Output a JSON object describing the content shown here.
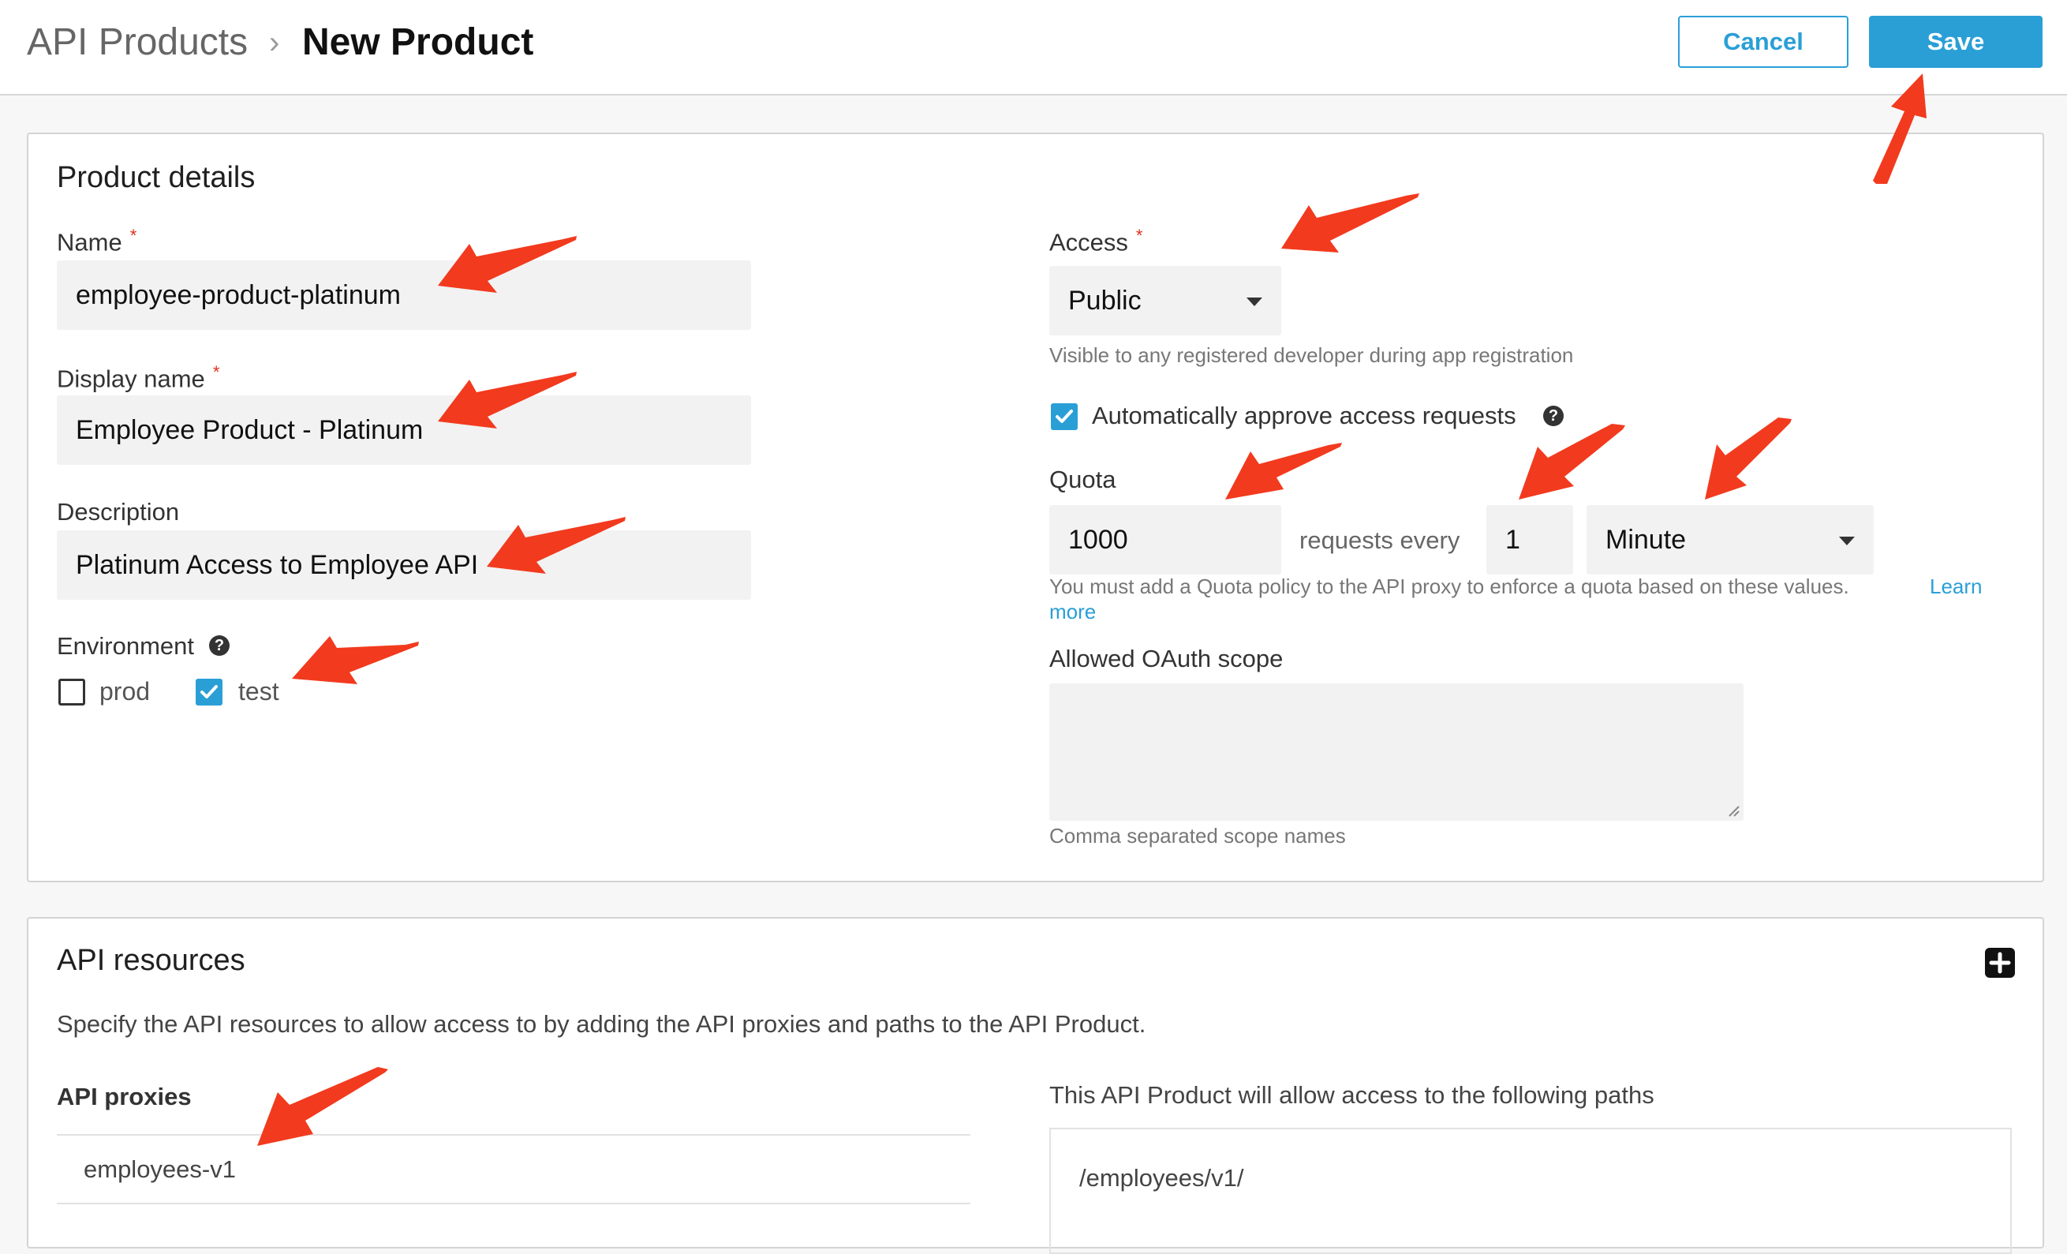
{
  "header": {
    "breadcrumb_parent": "API Products",
    "breadcrumb_sep": "›",
    "breadcrumb_current": "New Product",
    "cancel_label": "Cancel",
    "save_label": "Save"
  },
  "product_details": {
    "title": "Product details",
    "name": {
      "label": "Name",
      "required": "*",
      "value": "employee-product-platinum"
    },
    "display_name": {
      "label": "Display name",
      "required": "*",
      "value": "Employee Product - Platinum"
    },
    "description": {
      "label": "Description",
      "value": "Platinum Access to Employee API"
    },
    "environment": {
      "label": "Environment",
      "help_icon": "?",
      "options": [
        {
          "label": "prod",
          "checked": false
        },
        {
          "label": "test",
          "checked": true
        }
      ]
    },
    "access": {
      "label": "Access",
      "required": "*",
      "value": "Public",
      "hint": "Visible to any registered developer during app registration"
    },
    "auto_approve": {
      "label": "Automatically approve access requests",
      "checked": true,
      "help_icon": "?"
    },
    "quota": {
      "label": "Quota",
      "amount": "1000",
      "requests_every": "requests every",
      "interval": "1",
      "unit": "Minute",
      "hint": "You must add a Quota policy to the API proxy to enforce a quota based on these values.",
      "learn_more": "Learn more",
      "learn_more_line1": "Learn",
      "learn_more_line2": "more"
    },
    "oauth_scope": {
      "label": "Allowed OAuth scope",
      "value": "",
      "hint": "Comma separated scope names"
    }
  },
  "api_resources": {
    "title": "API resources",
    "description": "Specify the API resources to allow access to by adding the API proxies and paths to the API Product.",
    "add_icon": "plus-square-icon",
    "proxies_label": "API proxies",
    "proxies": [
      "employees-v1"
    ],
    "paths_label": "This API Product will allow access to the following paths",
    "paths": [
      "/employees/v1/"
    ]
  },
  "colors": {
    "accent": "#2a9fd6",
    "annotation_arrow": "#f23a1e",
    "required": "#e0301e"
  }
}
